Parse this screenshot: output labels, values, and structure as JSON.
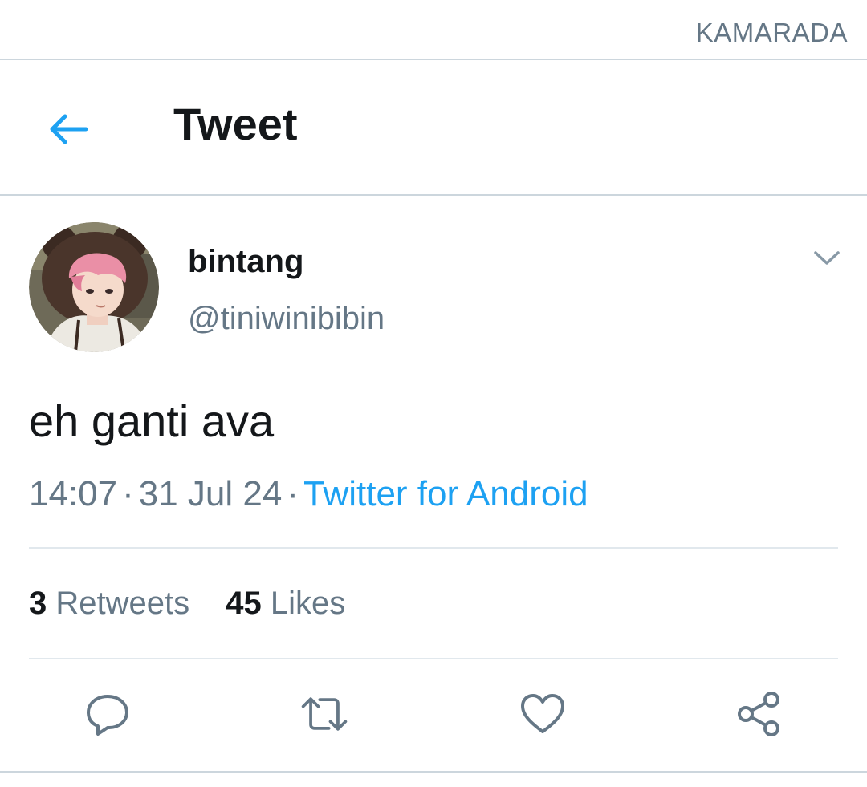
{
  "status_bar": {
    "carrier": "KAMARADA"
  },
  "header": {
    "back_icon": "arrow-left-icon",
    "title": "Tweet"
  },
  "tweet": {
    "author": {
      "display_name": "bintang",
      "username": "@tiniwinibibin",
      "avatar": "avatar-illustration"
    },
    "menu_icon": "chevron-down-icon",
    "text": "eh ganti ava",
    "time": "14:07",
    "separator": "·",
    "date": "31 Jul 24",
    "source": "Twitter for Android",
    "stats": {
      "retweets_count": "3",
      "retweets_label": "Retweets",
      "likes_count": "45",
      "likes_label": "Likes"
    },
    "actions": [
      {
        "name": "reply",
        "icon": "reply-bubble-icon"
      },
      {
        "name": "retweet",
        "icon": "retweet-icon"
      },
      {
        "name": "like",
        "icon": "heart-icon"
      },
      {
        "name": "share",
        "icon": "share-icon"
      }
    ]
  },
  "colors": {
    "accent": "#1da1f2",
    "text_primary": "#14171a",
    "text_secondary": "#657786",
    "divider": "#ccd6dd"
  }
}
